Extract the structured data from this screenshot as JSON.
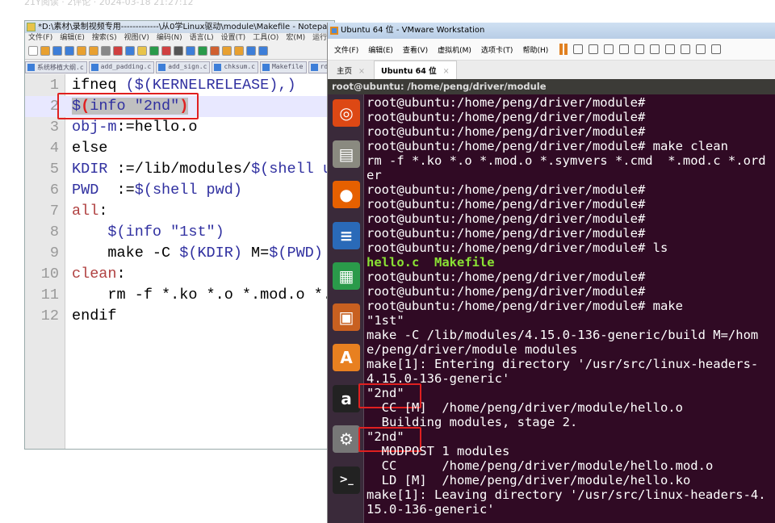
{
  "top_caption": "21Y阅读 · 2评论 · 2024-03-18 21:27:12",
  "npp": {
    "title": "*D:\\素材\\录制视频专用-------------\\从0学Linux驱动\\module\\Makefile - Notepad++ [Ad",
    "menu": [
      "文件(F)",
      "编辑(E)",
      "搜索(S)",
      "视图(V)",
      "编码(N)",
      "语言(L)",
      "设置(T)",
      "工具(O)",
      "宏(M)",
      "运行(R)"
    ],
    "tabs": [
      "系统移植大纲.c",
      "add_padding.c",
      "add_sign.c",
      "chksum.c",
      "Makefile",
      "rd"
    ],
    "lines": [
      [
        [
          "ifneq ",
          "k"
        ],
        [
          "($(KERNELRELEASE),)",
          "v"
        ]
      ],
      [
        [
          "$",
          "v"
        ],
        [
          "(",
          "r"
        ],
        [
          "info \"2nd\"",
          "v"
        ],
        [
          ")",
          "r"
        ]
      ],
      [
        [
          "obj-m",
          "v"
        ],
        [
          ":=",
          "k"
        ],
        [
          "hello.o",
          "k"
        ]
      ],
      [
        [
          "else",
          "k"
        ]
      ],
      [
        [
          "KDIR ",
          "v"
        ],
        [
          ":=",
          "k"
        ],
        [
          "/lib/modules/",
          "k"
        ],
        [
          "$(shell uname -r)/build",
          "v"
        ]
      ],
      [
        [
          "PWD  ",
          "v"
        ],
        [
          ":=",
          "k"
        ],
        [
          "$(shell pwd)",
          "v"
        ]
      ],
      [
        [
          "all",
          "t"
        ],
        [
          ":",
          "k"
        ]
      ],
      [
        [
          "    ",
          "k"
        ],
        [
          "$(info \"1st\")",
          "v"
        ]
      ],
      [
        [
          "    make -C ",
          "k"
        ],
        [
          "$(KDIR)",
          "v"
        ],
        [
          " M=",
          "k"
        ],
        [
          "$(PWD) modules",
          "v"
        ]
      ],
      [
        [
          "clean",
          "t"
        ],
        [
          ":",
          "k"
        ]
      ],
      [
        [
          "    rm -f *.ko *.o *.mod.o *.symvers *.cmd",
          "k"
        ]
      ],
      [
        [
          "endif",
          "k"
        ]
      ]
    ]
  },
  "vm": {
    "title": "Ubuntu 64 位 - VMware Workstation",
    "menu": [
      "文件(F)",
      "编辑(E)",
      "查看(V)",
      "虚拟机(M)",
      "选项卡(T)",
      "帮助(H)"
    ],
    "tabs": [
      {
        "label": "主页",
        "active": false
      },
      {
        "label": "Ubuntu 64 位",
        "active": true
      }
    ],
    "terminal_title": "root@ubuntu: /home/peng/driver/module",
    "launcher": [
      "ubuntu-dash",
      "files",
      "firefox",
      "writer",
      "calc",
      "impress",
      "software-center",
      "amazon",
      "system-settings",
      "terminal"
    ],
    "terminal_lines": [
      {
        "text": "root@ubuntu:/home/peng/driver/module#"
      },
      {
        "text": "root@ubuntu:/home/peng/driver/module#"
      },
      {
        "text": "root@ubuntu:/home/peng/driver/module#"
      },
      {
        "text": "root@ubuntu:/home/peng/driver/module# make clean"
      },
      {
        "text": "rm -f *.ko *.o *.mod.o *.symvers *.cmd  *.mod.c *.order"
      },
      {
        "text": "root@ubuntu:/home/peng/driver/module#"
      },
      {
        "text": "root@ubuntu:/home/peng/driver/module#"
      },
      {
        "text": "root@ubuntu:/home/peng/driver/module#"
      },
      {
        "text": "root@ubuntu:/home/peng/driver/module#"
      },
      {
        "text": "root@ubuntu:/home/peng/driver/module# ls"
      },
      {
        "text": "hello.c  Makefile",
        "green": true
      },
      {
        "text": "root@ubuntu:/home/peng/driver/module#"
      },
      {
        "text": "root@ubuntu:/home/peng/driver/module#"
      },
      {
        "text": "root@ubuntu:/home/peng/driver/module# make"
      },
      {
        "text": "\"1st\""
      },
      {
        "text": "make -C /lib/modules/4.15.0-136-generic/build M=/home/peng/driver/module modules"
      },
      {
        "text": "make[1]: Entering directory '/usr/src/linux-headers-4.15.0-136-generic'"
      },
      {
        "text": "\"2nd\""
      },
      {
        "text": "  CC [M]  /home/peng/driver/module/hello.o"
      },
      {
        "text": "  Building modules, stage 2."
      },
      {
        "text": "\"2nd\""
      },
      {
        "text": "  MODPOST 1 modules"
      },
      {
        "text": "  CC      /home/peng/driver/module/hello.mod.o"
      },
      {
        "text": "  LD [M]  /home/peng/driver/module/hello.ko"
      },
      {
        "text": "make[1]: Leaving directory '/usr/src/linux-headers-4.15.0-136-generic'"
      }
    ]
  },
  "colors": {
    "highlight_box": "#e02020",
    "terminal_bg": "#300a24"
  }
}
